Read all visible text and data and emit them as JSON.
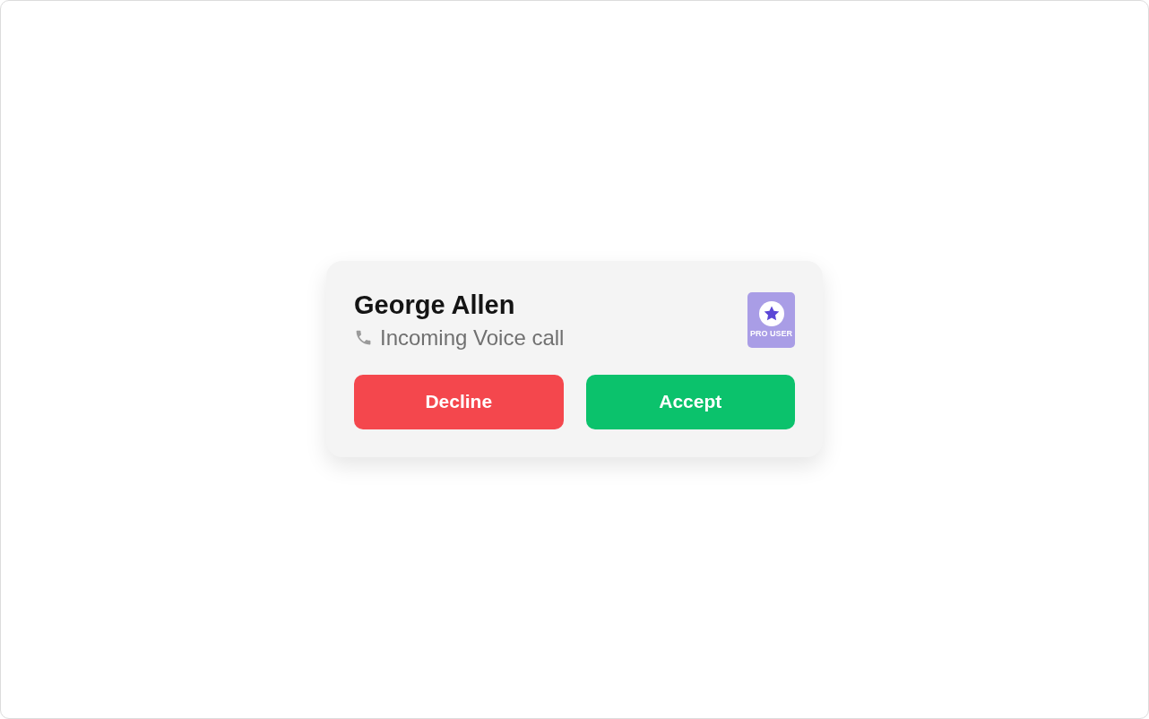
{
  "caller": {
    "name": "George Allen",
    "call_type": "Incoming Voice call"
  },
  "badge": {
    "label": "PRO USER"
  },
  "buttons": [
    {
      "label": "Decline",
      "kind": "decline"
    },
    {
      "label": "Accept",
      "kind": "accept"
    }
  ]
}
